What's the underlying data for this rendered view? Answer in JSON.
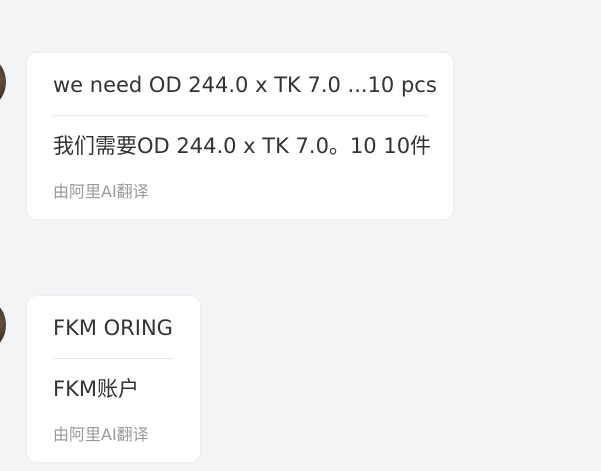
{
  "messages": [
    {
      "original": "we need OD 244.0 x TK 7.0 ...10 pcs",
      "translated": "我们需要OD 244.0 x TK 7.0。10 10件",
      "translation_note": "由阿里AI翻译"
    },
    {
      "original": "FKM ORING",
      "translated": "FKM账户",
      "translation_note": "由阿里AI翻译"
    }
  ],
  "colors": {
    "background": "#f3f4f6",
    "bubble": "#ffffff",
    "text": "#333333",
    "note": "#9a9a9a",
    "divider": "#e6e8eb"
  }
}
